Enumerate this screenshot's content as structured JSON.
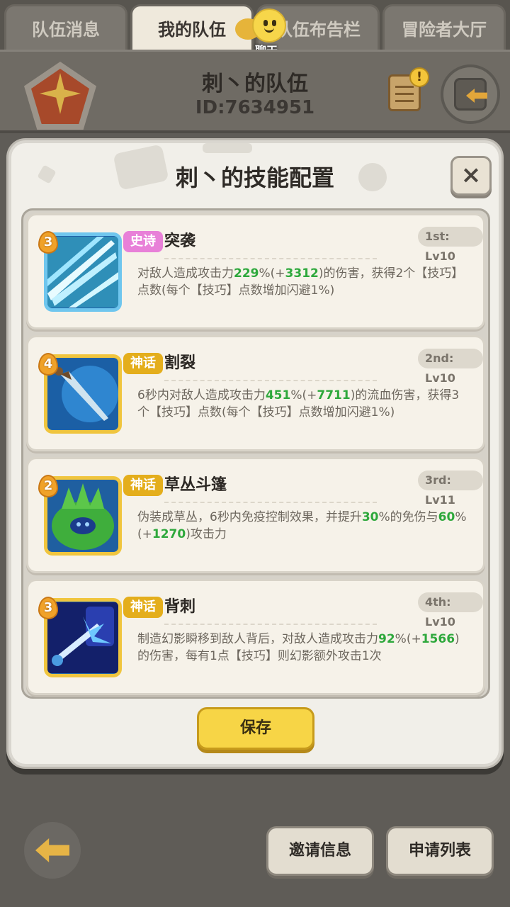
{
  "tabs": [
    {
      "label": "队伍消息",
      "active": false
    },
    {
      "label": "我的队伍",
      "active": true
    },
    {
      "label": "队伍布告栏",
      "active": false
    },
    {
      "label": "冒险者大厅",
      "active": false
    }
  ],
  "chat": {
    "label": "聊天",
    "icon": "chat-bubble-icon"
  },
  "team": {
    "name": "刺丶的队伍",
    "id": "ID:7634951",
    "emblem_icon": "team-emblem-icon",
    "notice_icon": "scroll-notice-icon",
    "notice_alert": "!",
    "exit_icon": "exit-door-icon"
  },
  "modal": {
    "title": "刺丶的技能配置",
    "close_label": "×",
    "save_label": "保存"
  },
  "skills": [
    {
      "level": "3",
      "rarity": "史诗",
      "name": "突袭",
      "slot": "1st: Lv10",
      "desc": [
        {
          "t": "对敌人造成攻击力"
        },
        {
          "t": "229",
          "hl": true
        },
        {
          "t": "%(+"
        },
        {
          "t": "3312",
          "hl": true
        },
        {
          "t": ")的伤害，获得2个【技巧】点数(每个【技巧】点数增加闪避1%)"
        }
      ],
      "icon": "dash-slash-icon"
    },
    {
      "level": "4",
      "rarity": "神话",
      "name": "割裂",
      "slot": "2nd: Lv10",
      "desc": [
        {
          "t": "6秒内对敌人造成攻击力"
        },
        {
          "t": "451",
          "hl": true
        },
        {
          "t": "%(+"
        },
        {
          "t": "7711",
          "hl": true
        },
        {
          "t": ")的流血伤害，获得3个【技巧】点数(每个【技巧】点数增加闪避1%)"
        }
      ],
      "icon": "dagger-icon"
    },
    {
      "level": "2",
      "rarity": "神话",
      "name": "草丛斗篷",
      "slot": "3rd: Lv11",
      "desc": [
        {
          "t": "伪装成草丛，6秒内免疫控制效果，并提升"
        },
        {
          "t": "30",
          "hl": true
        },
        {
          "t": "%的免伤与"
        },
        {
          "t": "60",
          "hl": true
        },
        {
          "t": "%(+"
        },
        {
          "t": "1270",
          "hl": true
        },
        {
          "t": ")攻击力"
        }
      ],
      "icon": "bush-cloak-icon"
    },
    {
      "level": "3",
      "rarity": "神话",
      "name": "背刺",
      "slot": "4th: Lv10",
      "desc": [
        {
          "t": "制造幻影瞬移到敌人背后，对敌人造成攻击力"
        },
        {
          "t": "92",
          "hl": true
        },
        {
          "t": "%(+"
        },
        {
          "t": "1566",
          "hl": true
        },
        {
          "t": ")的伤害，每有1点【技巧】则幻影额外攻击1次"
        }
      ],
      "icon": "backstab-icon"
    }
  ],
  "bottom": {
    "back_icon": "back-arrow-icon",
    "invite_label": "邀请信息",
    "apply_label": "申请列表"
  }
}
